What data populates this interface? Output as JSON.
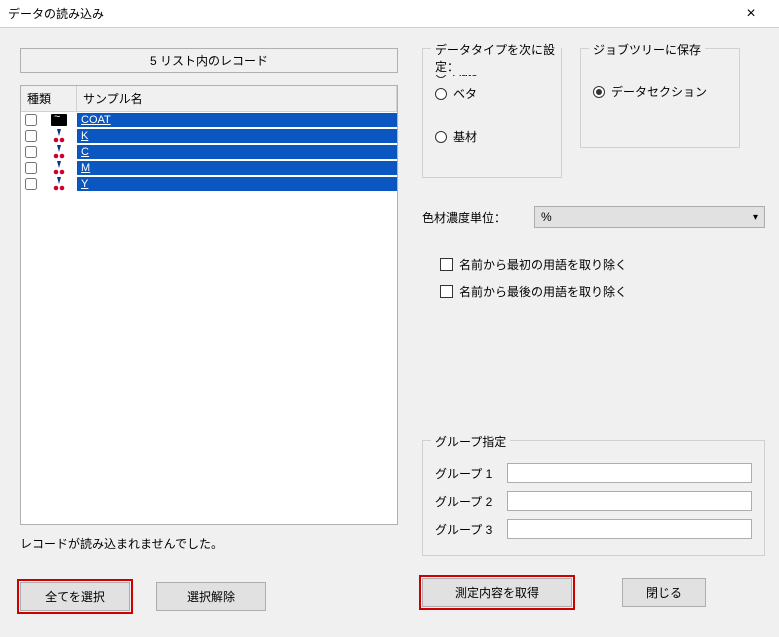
{
  "title": "データの読み込み",
  "list_header": "5 リスト内のレコード",
  "columns": {
    "type": "種類",
    "name": "サンプル名"
  },
  "rows": [
    {
      "icon": "wave",
      "name": "COAT"
    },
    {
      "icon": "colorant",
      "name": "K"
    },
    {
      "icon": "colorant",
      "name": "C"
    },
    {
      "icon": "colorant",
      "name": "M"
    },
    {
      "icon": "colorant",
      "name": "Y"
    }
  ],
  "status": "レコードが読み込まれませんでした。",
  "buttons": {
    "select_all": "全てを選択",
    "deselect": "選択解除",
    "get_measurements": "測定内容を取得",
    "close": "閉じる"
  },
  "datatype": {
    "legend": "データタイプを次に設定：",
    "options": {
      "auto": "Auto",
      "beta": "ベタ",
      "substrate": "基材"
    },
    "selected": "auto"
  },
  "jobtree": {
    "legend": "ジョブツリーに保存",
    "options": {
      "data_section": "データセクション"
    },
    "selected": "data_section"
  },
  "unit": {
    "label": "色材濃度単位：",
    "value": "%"
  },
  "remove_first": "名前から最初の用語を取り除く",
  "remove_last": "名前から最後の用語を取り除く",
  "group_spec": {
    "legend": "グループ指定",
    "g1_label": "グループ 1",
    "g2_label": "グループ 2",
    "g3_label": "グループ 3",
    "g1_value": "",
    "g2_value": "",
    "g3_value": ""
  }
}
